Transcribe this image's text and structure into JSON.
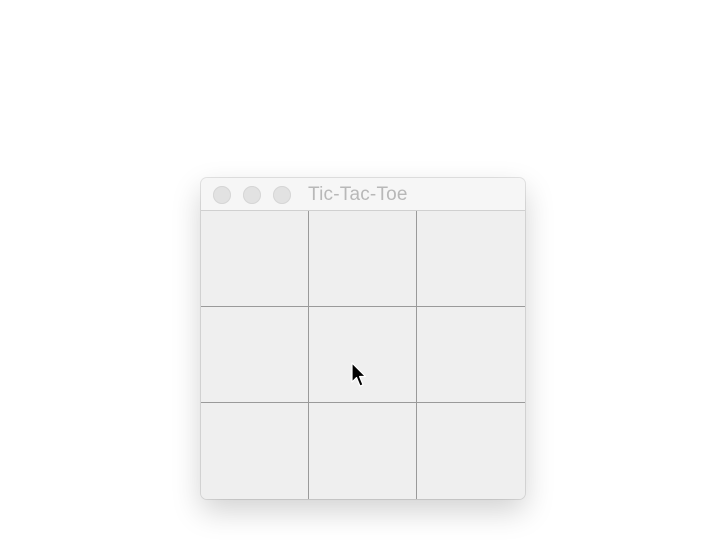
{
  "window": {
    "title": "Tic-Tac-Toe",
    "traffic_lights": [
      "close-button",
      "minimize-button",
      "zoom-button"
    ]
  },
  "board": {
    "rows": 3,
    "cols": 3,
    "cells": [
      [
        "",
        "",
        ""
      ],
      [
        "",
        "",
        ""
      ],
      [
        "",
        "",
        ""
      ]
    ]
  },
  "cursor": {
    "icon": "arrow-cursor"
  },
  "colors": {
    "background": "#ffffff",
    "window": "#efefef",
    "titlebar": "#f6f6f6",
    "grid_line": "#9a9a9a",
    "title_text": "#b8b8b8"
  }
}
